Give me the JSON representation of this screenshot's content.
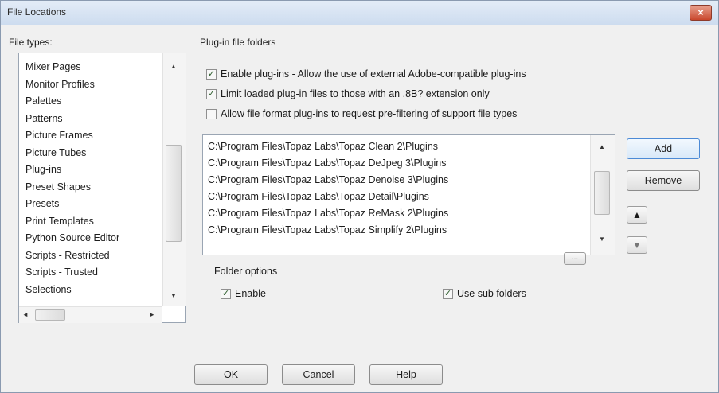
{
  "window": {
    "title": "File Locations",
    "close_glyph": "×"
  },
  "file_types": {
    "label": "File types:",
    "items": [
      "Mixer Pages",
      "Monitor Profiles",
      "Palettes",
      "Patterns",
      "Picture Frames",
      "Picture Tubes",
      "Plug-ins",
      "Preset Shapes",
      "Presets",
      "Print Templates",
      "Python Source Editor",
      "Scripts - Restricted",
      "Scripts - Trusted",
      "Selections"
    ]
  },
  "plugin": {
    "section_label": "Plug-in file folders",
    "checkboxes": [
      {
        "label": "Enable plug-ins - Allow the use of external Adobe-compatible plug-ins",
        "checked": true
      },
      {
        "label": "Limit loaded plug-in files to those with an .8B? extension only",
        "checked": true
      },
      {
        "label": "Allow file format plug-ins to request pre-filtering of support file types",
        "checked": false
      }
    ],
    "folders": [
      "C:\\Program Files\\Topaz Labs\\Topaz Clean 2\\Plugins",
      "C:\\Program Files\\Topaz Labs\\Topaz DeJpeg 3\\Plugins",
      "C:\\Program Files\\Topaz Labs\\Topaz Denoise 3\\Plugins",
      "C:\\Program Files\\Topaz Labs\\Topaz Detail\\Plugins",
      "C:\\Program Files\\Topaz Labs\\Topaz ReMask 2\\Plugins",
      "C:\\Program Files\\Topaz Labs\\Topaz Simplify 2\\Plugins"
    ],
    "folder_options_label": "Folder options",
    "enable_label": "Enable",
    "subfolders_label": "Use sub folders",
    "check_glyph": "✓",
    "browse_glyph": "..."
  },
  "side_buttons": {
    "add": "Add",
    "remove": "Remove",
    "up": "▲",
    "down": "▼"
  },
  "footer": {
    "ok": "OK",
    "cancel": "Cancel",
    "help": "Help"
  },
  "scroll_glyphs": {
    "up": "▲",
    "down": "▼",
    "left": "◄",
    "right": "►"
  }
}
